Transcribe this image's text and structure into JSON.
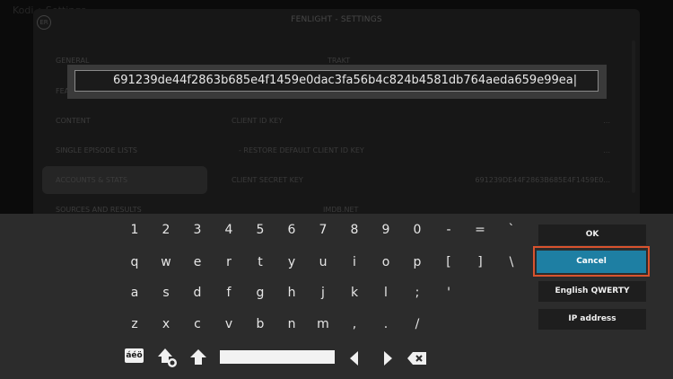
{
  "window_title": "Kodi • Settings",
  "dialog": {
    "title": "FENLIGHT - SETTINGS",
    "logo_text": "ER",
    "categories": [
      "GENERAL",
      "FEATURES",
      "CONTENT",
      "SINGLE EPISODE LISTS",
      "ACCOUNTS & STATS",
      "SOURCES AND RESULTS"
    ],
    "settings": [
      {
        "label": "TRAKT",
        "value": ""
      },
      {
        "label": "CLIENT ID KEY",
        "value": "..."
      },
      {
        "label": "- RESTORE DEFAULT CLIENT ID KEY",
        "value": "..."
      },
      {
        "label": "CLIENT SECRET KEY",
        "value": "691239DE44F2863B685E4F1459E0..."
      },
      {
        "label": "IMDB.NET",
        "value": ""
      }
    ]
  },
  "input": {
    "value": "691239de44f2863b685e4f1459e0dac3fa56b4c824b4581db764aeda659e99ea|"
  },
  "keyboard": {
    "row1": [
      "1",
      "2",
      "3",
      "4",
      "5",
      "6",
      "7",
      "8",
      "9",
      "0",
      "-",
      "=",
      "`"
    ],
    "row2": [
      "q",
      "w",
      "e",
      "r",
      "t",
      "y",
      "u",
      "i",
      "o",
      "p",
      "[",
      "]",
      "\\"
    ],
    "row3": [
      "a",
      "s",
      "d",
      "f",
      "g",
      "h",
      "j",
      "k",
      "l",
      ";",
      "'"
    ],
    "row4": [
      "z",
      "x",
      "c",
      "v",
      "b",
      "n",
      "m",
      ",",
      ".",
      "/"
    ],
    "special_label": "áéö"
  },
  "side_buttons": {
    "ok": "OK",
    "cancel": "Cancel",
    "layout": "English QWERTY",
    "ip": "IP address"
  },
  "colors": {
    "focus_blue": "#1e7fa3",
    "highlight_outline": "#d9532e"
  }
}
